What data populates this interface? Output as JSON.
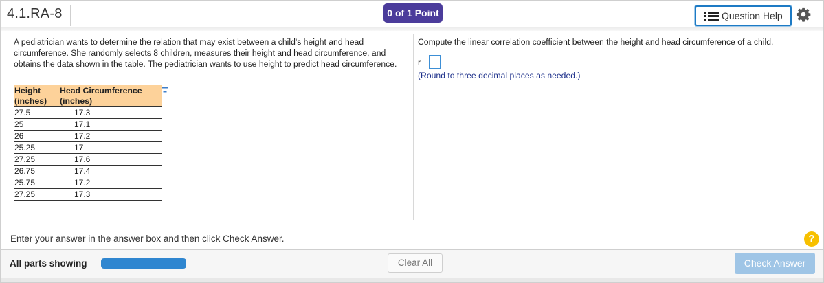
{
  "header": {
    "question_id": "4.1.RA-8",
    "points_badge": "0 of 1 Point",
    "help_button_label": "Question Help",
    "help_icon": "list-icon",
    "settings_icon": "gear-icon"
  },
  "problem": {
    "text": "A pediatrician wants to determine the relation that may exist between a child's  height and head circumference. She randomly selects 8 children, measures their height and head circumference, and obtains the data shown in the table. The pediatrician wants to use height to predict head circumference.",
    "table": {
      "headers": [
        "Height (inches)",
        "Head Circumference (inches)"
      ],
      "rows": [
        [
          "27.5",
          "17.3"
        ],
        [
          "25",
          "17.1"
        ],
        [
          "26",
          "17.2"
        ],
        [
          "25.25",
          "17"
        ],
        [
          "27.25",
          "17.6"
        ],
        [
          "26.75",
          "17.4"
        ],
        [
          "25.75",
          "17.2"
        ],
        [
          "27.25",
          "17.3"
        ]
      ]
    },
    "popout_icon": "popout-icon"
  },
  "answer": {
    "instruction": "Compute the linear correlation coefficient between the height and head circumference of a child.",
    "label": "r =",
    "value": "",
    "note": "(Round to three decimal places as needed.)"
  },
  "footer": {
    "instruction": "Enter your answer in the answer box and then click Check Answer.",
    "help_symbol": "?",
    "parts_label": "All parts showing",
    "progress_fraction": 1.0,
    "clear_label": "Clear All",
    "check_label": "Check Answer"
  },
  "colors": {
    "badge": "#4b3c9b",
    "accent": "#1d7ac4",
    "table_header": "#fdd29a",
    "note_text": "#1c2f8a",
    "check_button": "#9fc5e6",
    "help_circle": "#f7c000"
  }
}
